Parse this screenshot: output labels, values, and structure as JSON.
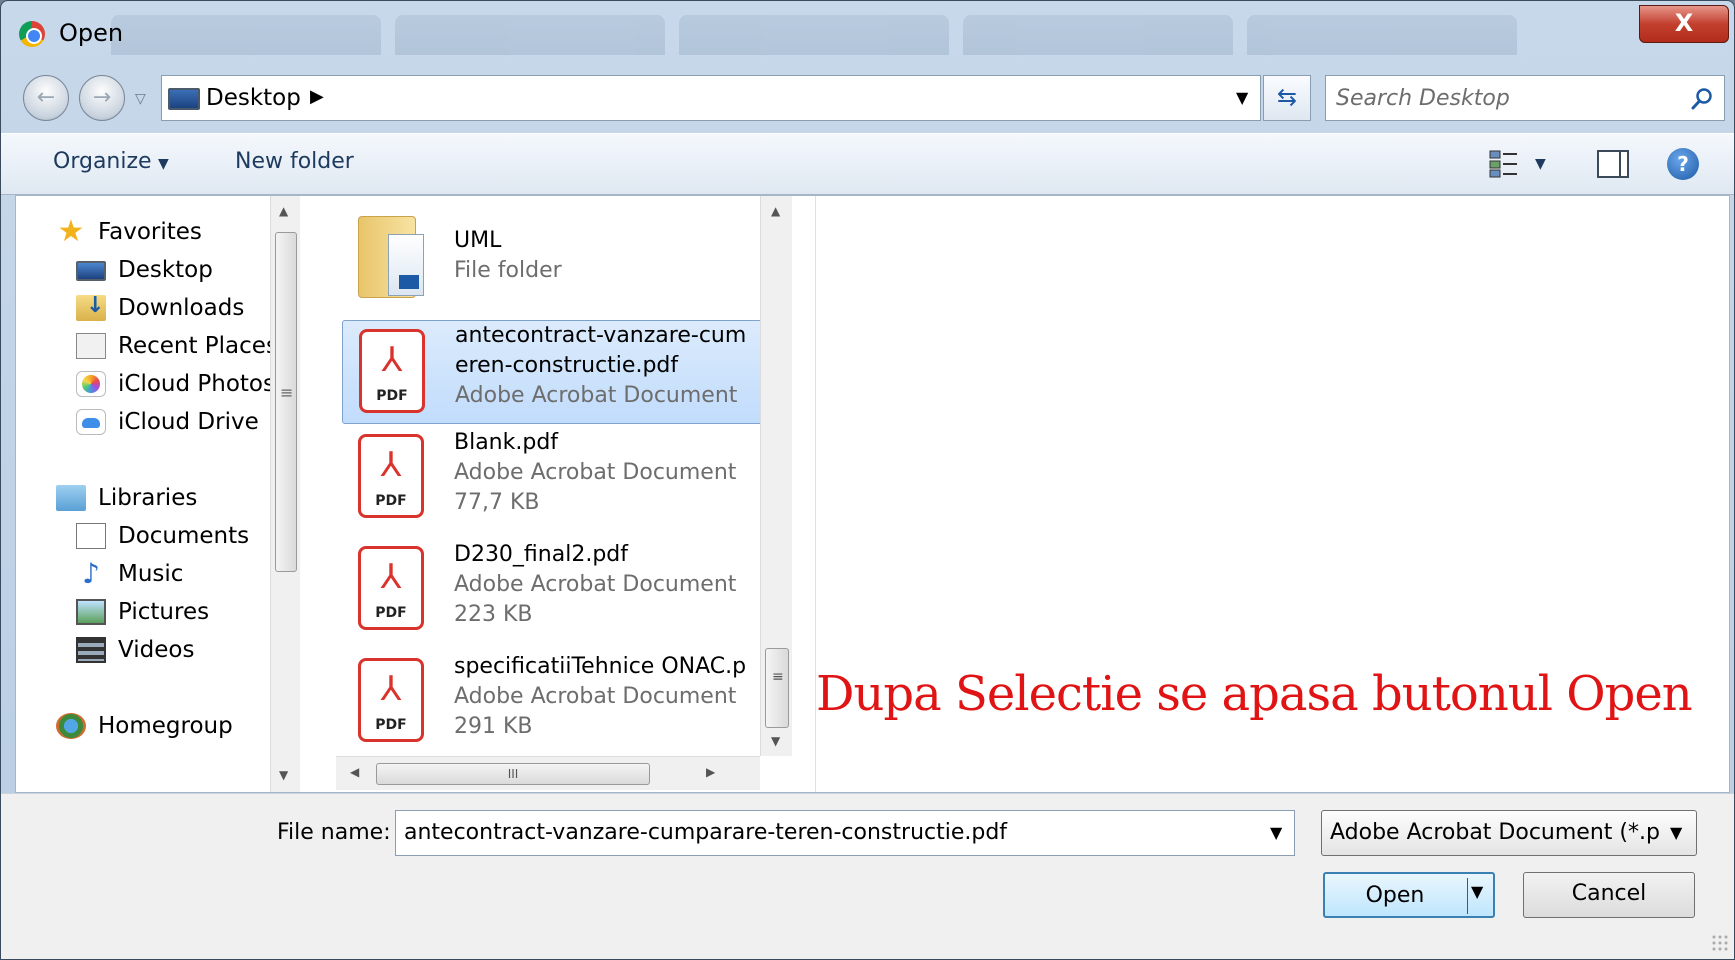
{
  "window": {
    "title": "Open",
    "close_label": "X"
  },
  "address": {
    "location": "Desktop",
    "search_placeholder": "Search Desktop"
  },
  "toolbar": {
    "organize_label": "Organize",
    "new_folder_label": "New folder",
    "help_label": "?"
  },
  "sidebar": {
    "items": [
      {
        "label": "Favorites",
        "icon": "star-icon"
      },
      {
        "label": "Desktop",
        "icon": "desktop-icon"
      },
      {
        "label": "Downloads",
        "icon": "downloads-icon"
      },
      {
        "label": "Recent Places",
        "icon": "recent-places-icon"
      },
      {
        "label": "iCloud Photos",
        "icon": "icloud-photos-icon"
      },
      {
        "label": "iCloud Drive",
        "icon": "icloud-drive-icon"
      },
      {
        "label": "Libraries",
        "icon": "libraries-icon"
      },
      {
        "label": "Documents",
        "icon": "documents-icon"
      },
      {
        "label": "Music",
        "icon": "music-icon"
      },
      {
        "label": "Pictures",
        "icon": "pictures-icon"
      },
      {
        "label": "Videos",
        "icon": "videos-icon"
      },
      {
        "label": "Homegroup",
        "icon": "homegroup-icon"
      }
    ]
  },
  "files": [
    {
      "name": "UML",
      "type": "File folder",
      "size": "",
      "icon": "folder-icon"
    },
    {
      "name": "antecontract-vanzare-cum",
      "name2": "eren-constructie.pdf",
      "type": "Adobe Acrobat Document",
      "size": "",
      "icon": "pdf-icon",
      "selected": true
    },
    {
      "name": "Blank.pdf",
      "type": "Adobe Acrobat Document",
      "size": "77,7 KB",
      "icon": "pdf-icon"
    },
    {
      "name": "D230_final2.pdf",
      "type": "Adobe Acrobat Document",
      "size": "223 KB",
      "icon": "pdf-icon"
    },
    {
      "name": "specificatiiTehnice ONAC.p",
      "type": "Adobe Acrobat Document",
      "size": "291 KB",
      "icon": "pdf-icon"
    }
  ],
  "pdf_tag": "PDF",
  "annotation": "Dupa Selectie se apasa butonul Open",
  "bottom": {
    "file_name_label": "File name:",
    "file_name_value": "antecontract-vanzare-cumparare-teren-constructie.pdf",
    "file_type_value": "Adobe Acrobat Document (*.pc",
    "open_label": "Open",
    "cancel_label": "Cancel"
  },
  "colors": {
    "annotation": "#e01414",
    "selection": "#c1dcfc",
    "pdf_red": "#d8332c"
  }
}
